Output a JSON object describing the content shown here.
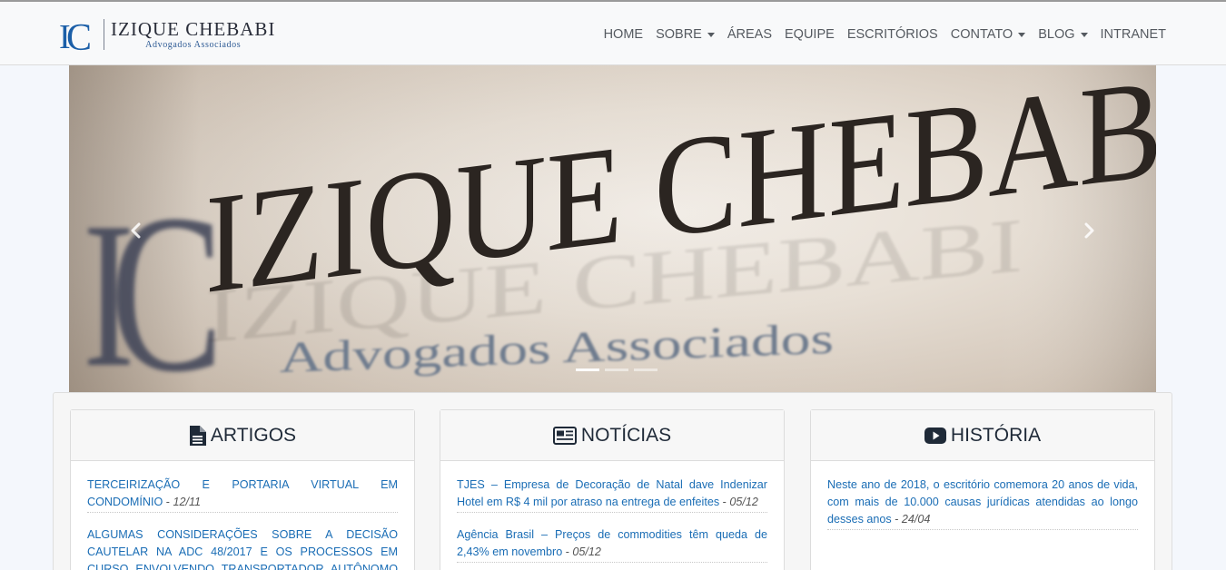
{
  "brand": {
    "title": "IZIQUE CHEBABI",
    "subtitle": "Advogados Associados",
    "mark": "IC",
    "primary_color": "#1b5fa8"
  },
  "nav": {
    "home": "HOME",
    "sobre": "SOBRE",
    "areas": "ÁREAS",
    "equipe": "EQUIPE",
    "escritorios": "ESCRITÓRIOS",
    "contato": "CONTATO",
    "blog": "BLOG",
    "intranet": "INTRANET"
  },
  "carousel": {
    "slide_text": "IZIQUE CHEBABI",
    "slide_subtext": "Advogados Associados",
    "prev_icon": "chevron-left-icon",
    "next_icon": "chevron-right-icon",
    "slide_count": 3,
    "active_slide": 1
  },
  "artigos": {
    "title": "ARTIGOS",
    "icon": "document-icon",
    "items": [
      {
        "text": "TERCEIRIZAÇÃO E PORTARIA VIRTUAL EM CONDOMÍNIO",
        "sep": " - ",
        "date": "12/11"
      },
      {
        "text": "ALGUMAS CONSIDERAÇÕES SOBRE A DECISÃO CAUTELAR NA ADC 48/2017 E OS PROCESSOS EM CURSO ENVOLVENDO TRANSPORTADOR AUTÔNOMO DE CARGA",
        "sep": " -",
        "date": ""
      }
    ]
  },
  "noticias": {
    "title": "NOTÍCIAS",
    "icon": "newspaper-icon",
    "items": [
      {
        "text": "TJES – Empresa de Decoração de Natal dave Indenizar Hotel em R$ 4 mil por atraso na entrega de enfeites",
        "sep": " - ",
        "date": "05/12"
      },
      {
        "text": "Agência Brasil – Preços de commodities têm queda de 2,43% em novembro",
        "sep": " - ",
        "date": "05/12"
      }
    ]
  },
  "historia": {
    "title": "HISTÓRIA",
    "icon": "youtube-icon",
    "items": [
      {
        "text": "Neste ano de 2018, o escritório comemora 20 anos de vida, com mais de 10.000 causas jurídicas atendidas ao longo desses anos",
        "sep": " - ",
        "date": "24/04"
      }
    ]
  }
}
